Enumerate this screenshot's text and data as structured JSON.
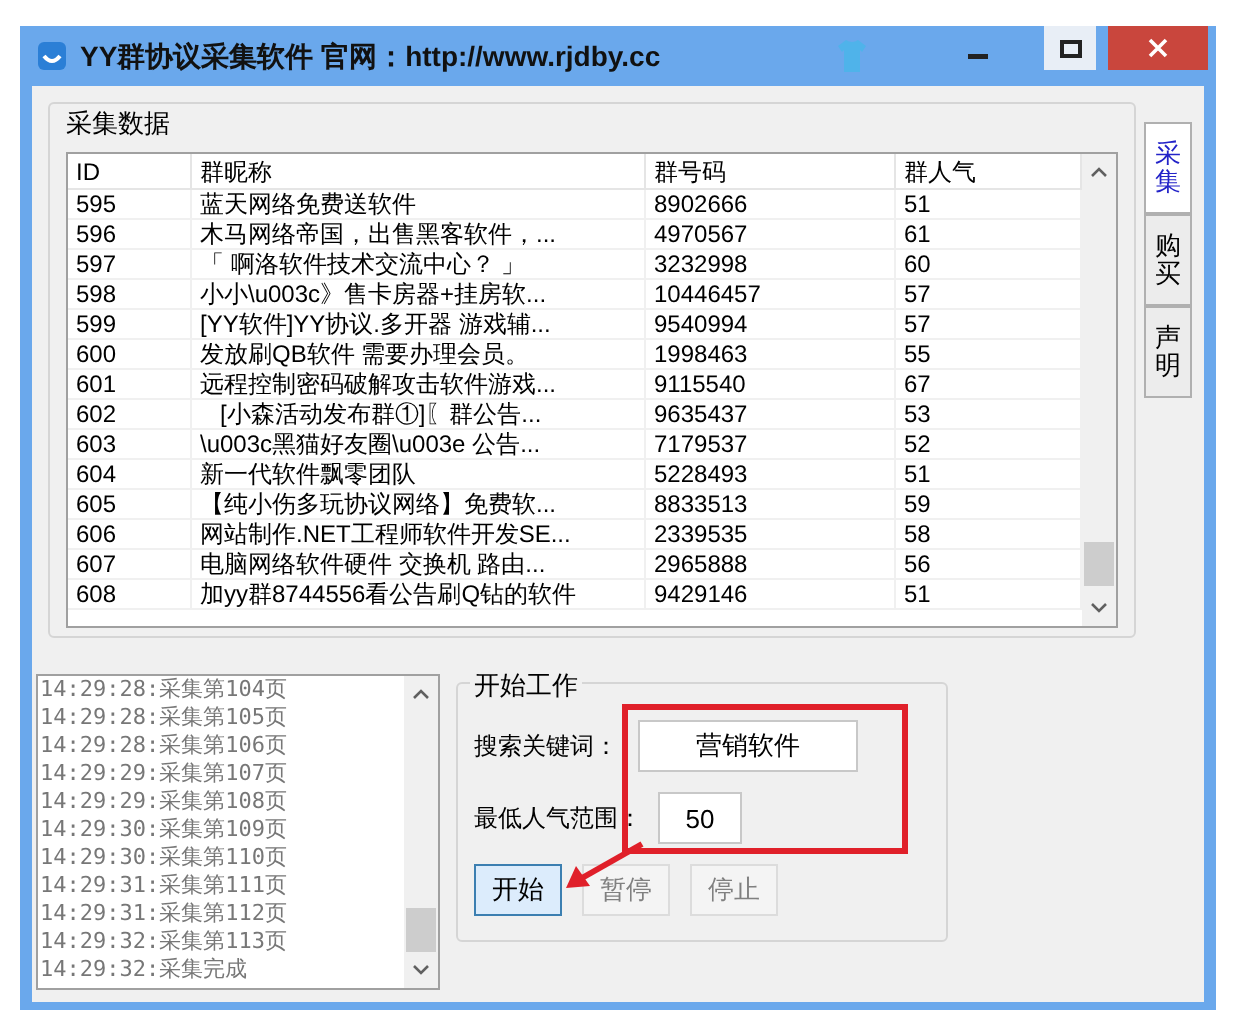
{
  "window": {
    "title": "YY群协议采集软件  官网：http://www.rjdby.cc"
  },
  "data_group": {
    "title": "采集数据"
  },
  "table": {
    "columns": [
      "ID",
      "群昵称",
      "群号码",
      "群人气"
    ],
    "rows": [
      [
        "595",
        "蓝天网络免费送软件",
        "8902666",
        "51"
      ],
      [
        "596",
        "木马网络帝国，出售黑客软件，...",
        "4970567",
        "61"
      ],
      [
        "597",
        "「 啊洛软件技术交流中心？ 」",
        "3232998",
        "60"
      ],
      [
        "598",
        "小小\\u003c》售卡房器+挂房软...",
        "10446457",
        "57"
      ],
      [
        "599",
        "[YY软件]YY协议.多开器 游戏辅...",
        "9540994",
        "57"
      ],
      [
        "600",
        "发放刷QB软件 需要办理会员。",
        "1998463",
        "55"
      ],
      [
        "601",
        "远程控制密码破解攻击软件游戏...",
        "9115540",
        "67"
      ],
      [
        "602",
        "   [小森活动发布群①]〖群公告...",
        "9635437",
        "53"
      ],
      [
        "603",
        "\\u003c黑猫好友圈\\u003e 公告...",
        "7179537",
        "52"
      ],
      [
        "604",
        "新一代软件飘零团队",
        "5228493",
        "51"
      ],
      [
        "605",
        "【纯小伤多玩协议网络】免费软...",
        "8833513",
        "59"
      ],
      [
        "606",
        "网站制作.NET工程师软件开发SE...",
        "2339535",
        "58"
      ],
      [
        "607",
        "电脑网络软件硬件 交换机 路由...",
        "2965888",
        "56"
      ],
      [
        "608",
        "加yy群8744556看公告刷Q钻的软件",
        "9429146",
        "51"
      ]
    ]
  },
  "side_tabs": [
    {
      "label": "采集",
      "selected": true
    },
    {
      "label": "购买",
      "selected": false
    },
    {
      "label": "声明",
      "selected": false
    }
  ],
  "log": [
    "14:29:28:采集第104页",
    "14:29:28:采集第105页",
    "14:29:28:采集第106页",
    "14:29:29:采集第107页",
    "14:29:29:采集第108页",
    "14:29:30:采集第109页",
    "14:29:30:采集第110页",
    "14:29:31:采集第111页",
    "14:29:31:采集第112页",
    "14:29:32:采集第113页",
    "14:29:32:采集完成"
  ],
  "work_group": {
    "title": "开始工作",
    "fields": [
      {
        "label": "搜索关键词：",
        "value": "营销软件"
      },
      {
        "label": "最低人气范围：",
        "value": "50"
      }
    ],
    "buttons": [
      {
        "label": "开始",
        "disabled": false,
        "focused": true
      },
      {
        "label": "暂停",
        "disabled": true,
        "focused": false
      },
      {
        "label": "停止",
        "disabled": true,
        "focused": false
      }
    ]
  }
}
